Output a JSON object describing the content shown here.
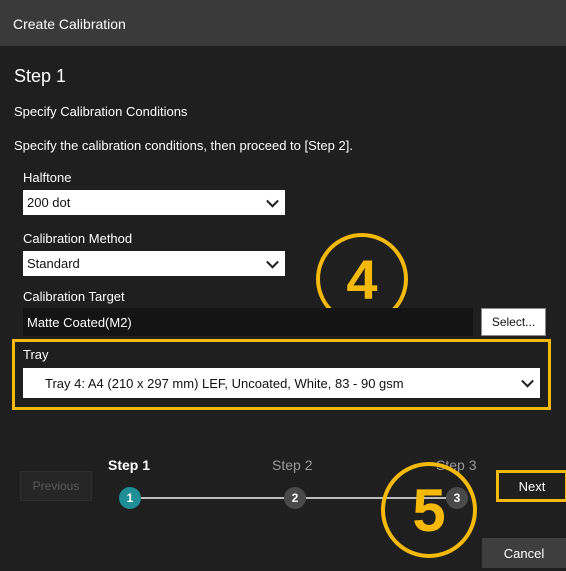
{
  "dialog": {
    "title": "Create Calibration"
  },
  "step": {
    "heading": "Step 1",
    "subheading": "Specify Calibration Conditions",
    "instruction": "Specify the calibration conditions, then proceed to [Step 2]."
  },
  "halftone": {
    "label": "Halftone",
    "value": "200 dot"
  },
  "method": {
    "label": "Calibration Method",
    "value": "Standard"
  },
  "target": {
    "label": "Calibration Target",
    "value": "Matte Coated(M2)",
    "select_label": "Select..."
  },
  "tray": {
    "label": "Tray",
    "value": "Tray 4: A4 (210 x 297 mm) LEF, Uncoated, White, 83 - 90 gsm"
  },
  "annotations": {
    "four": "4",
    "five": "5",
    "color": "#f4b90a"
  },
  "wizard": {
    "previous_label": "Previous",
    "steps": [
      {
        "label": "Step 1",
        "number": "1",
        "state": "active"
      },
      {
        "label": "Step 2",
        "number": "2",
        "state": "pending"
      },
      {
        "label": "Step 3",
        "number": "3",
        "state": "pending"
      }
    ],
    "next_label": "Next",
    "cancel_label": "Cancel"
  }
}
